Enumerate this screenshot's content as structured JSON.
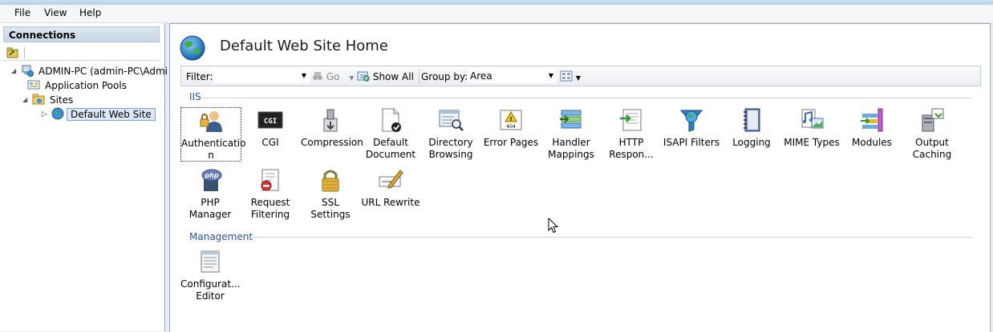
{
  "menu": [
    "File",
    "View",
    "Help"
  ],
  "connections": {
    "header": "Connections",
    "tree": {
      "server": "ADMIN-PC (admin-PC\\Admi",
      "app_pools": "Application Pools",
      "sites": "Sites",
      "default_site": "Default Web Site"
    }
  },
  "main": {
    "title": "Default Web Site Home",
    "filter": {
      "label": "Filter:",
      "value": "",
      "go": "Go",
      "show_all": "Show All",
      "group_by_label": "Group by:",
      "group_by_value": "Area"
    },
    "sections": {
      "iis": "IIS",
      "management": "Management"
    },
    "iis_features": [
      {
        "label": "Authenticatio n",
        "icon": "authentication-icon"
      },
      {
        "label": "CGI",
        "icon": "cgi-icon"
      },
      {
        "label": "Compression",
        "icon": "compression-icon"
      },
      {
        "label": "Default Document",
        "icon": "default-document-icon"
      },
      {
        "label": "Directory Browsing",
        "icon": "directory-browsing-icon"
      },
      {
        "label": "Error Pages",
        "icon": "error-pages-icon"
      },
      {
        "label": "Handler Mappings",
        "icon": "handler-mappings-icon"
      },
      {
        "label": "HTTP Respon...",
        "icon": "http-response-icon"
      },
      {
        "label": "ISAPI Filters",
        "icon": "isapi-filters-icon"
      },
      {
        "label": "Logging",
        "icon": "logging-icon"
      },
      {
        "label": "MIME Types",
        "icon": "mime-types-icon"
      },
      {
        "label": "Modules",
        "icon": "modules-icon"
      },
      {
        "label": "Output Caching",
        "icon": "output-caching-icon"
      },
      {
        "label": "PHP Manager",
        "icon": "php-manager-icon"
      },
      {
        "label": "Request Filtering",
        "icon": "request-filtering-icon"
      },
      {
        "label": "SSL Settings",
        "icon": "ssl-settings-icon"
      },
      {
        "label": "URL Rewrite",
        "icon": "url-rewrite-icon"
      }
    ],
    "management_features": [
      {
        "label": "Configurat... Editor",
        "icon": "configuration-editor-icon"
      }
    ]
  }
}
